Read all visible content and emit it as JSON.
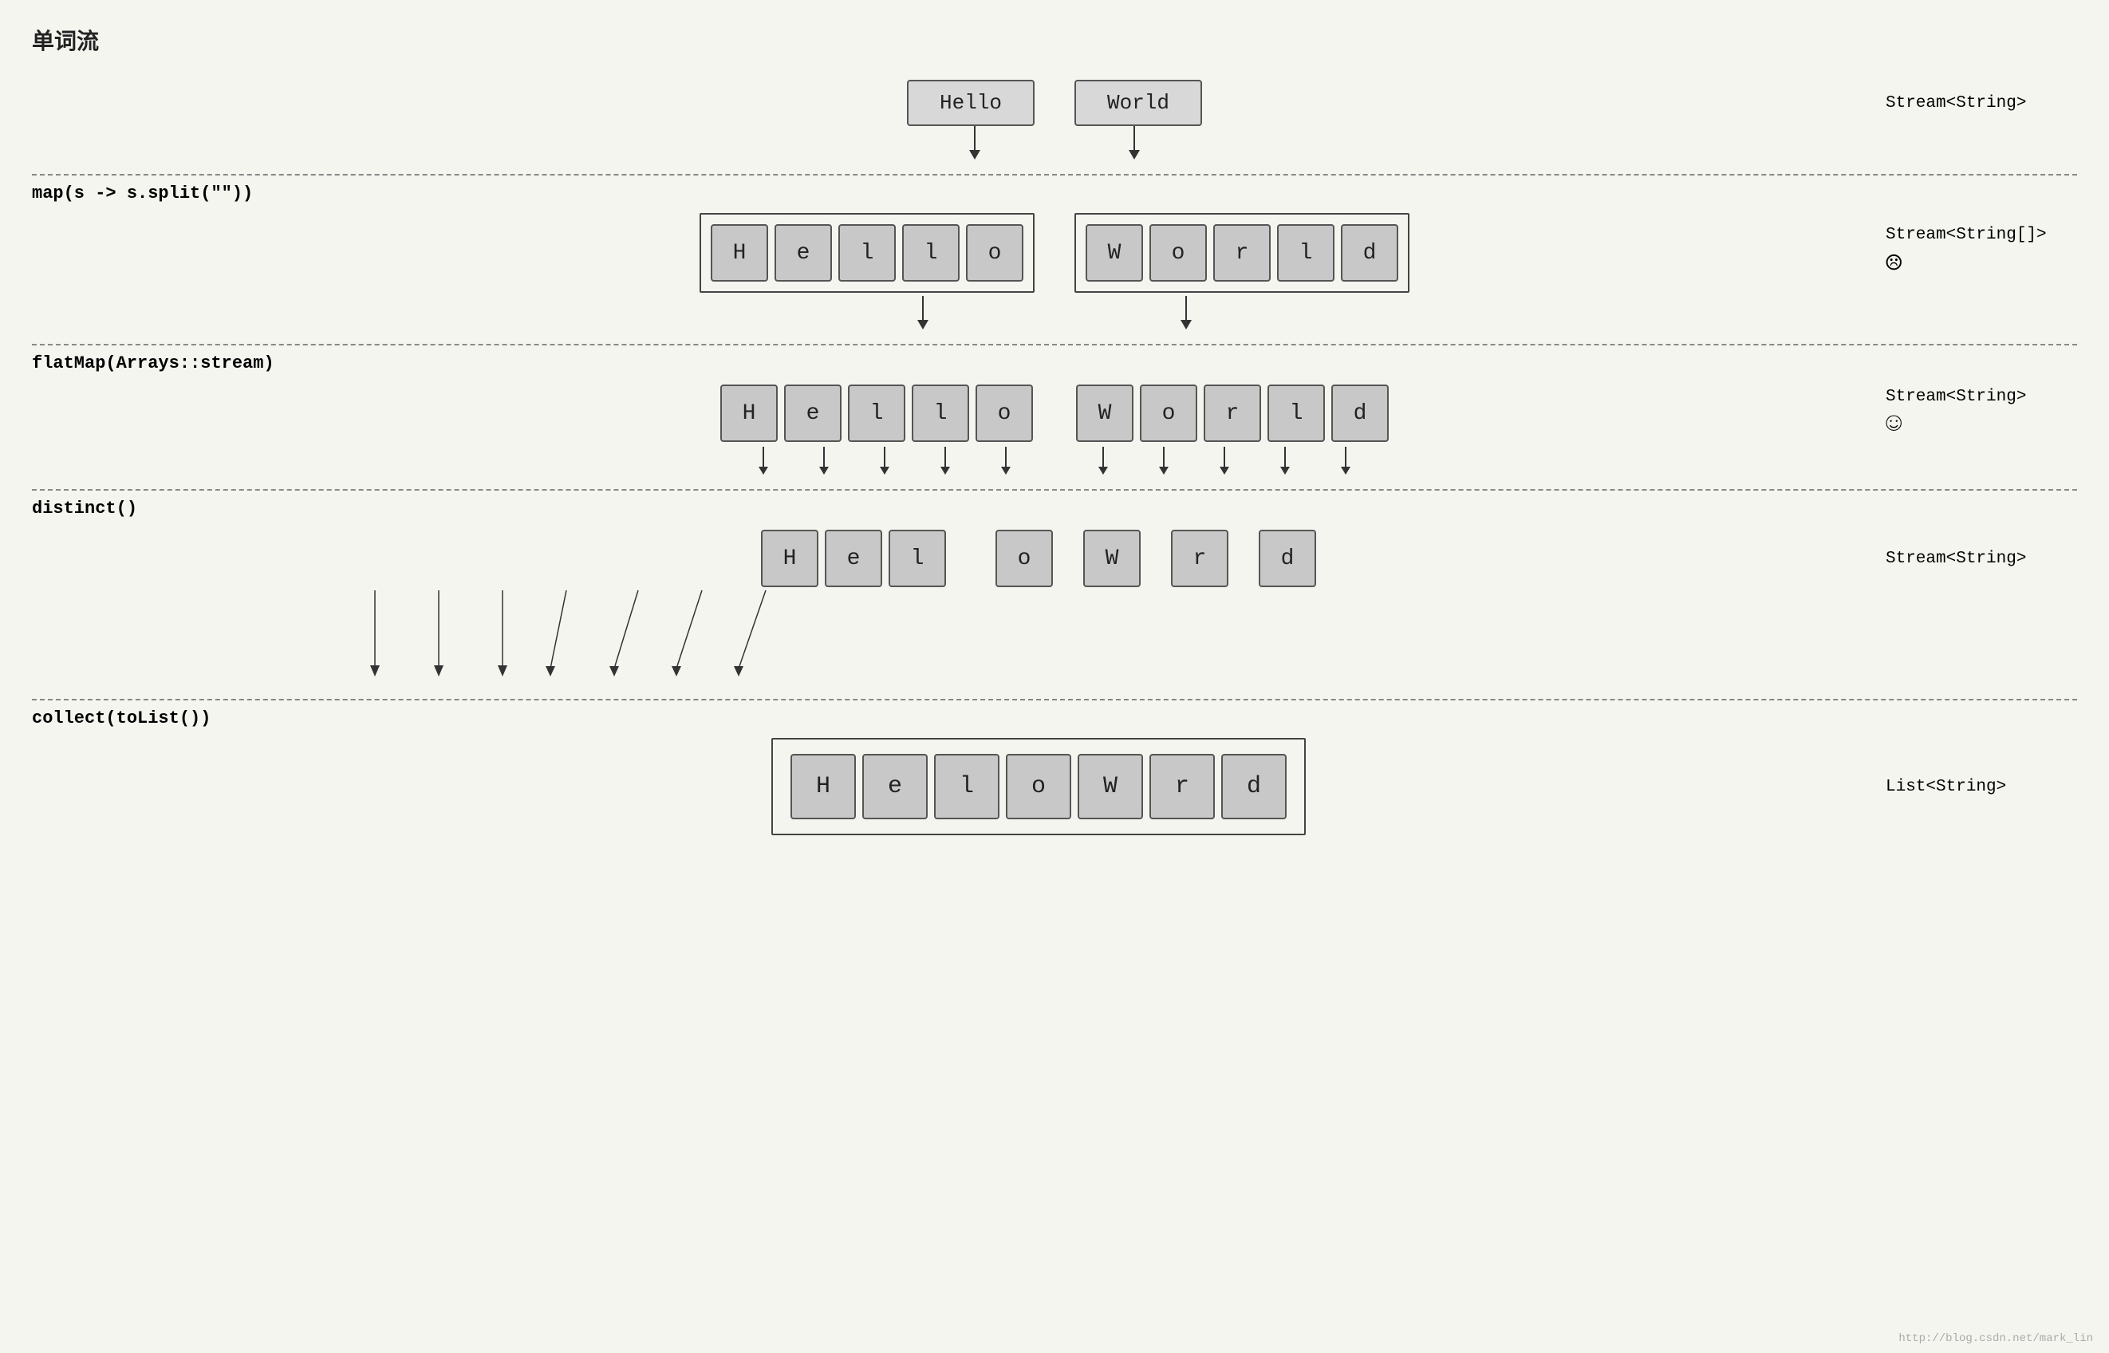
{
  "title": "单词流",
  "sections": {
    "top": {
      "words": [
        "Hello",
        "World"
      ],
      "stream_label": "Stream<String>"
    },
    "map": {
      "label_keyword": "map",
      "label_rest": "(s -> s.split(\"\"))",
      "hello_letters": [
        "H",
        "e",
        "l",
        "l",
        "o"
      ],
      "world_letters": [
        "W",
        "o",
        "r",
        "l",
        "d"
      ],
      "stream_label": "Stream<String[]>",
      "emoji": "☹"
    },
    "flatmap": {
      "label_keyword": "flatMap",
      "label_rest": "(Arrays::stream)",
      "letters": [
        "H",
        "e",
        "l",
        "l",
        "o",
        "W",
        "o",
        "r",
        "l",
        "d"
      ],
      "stream_label": "Stream<String>",
      "emoji": "☺"
    },
    "distinct": {
      "label_keyword": "distinct",
      "label_rest": "()",
      "letters": [
        "H",
        "e",
        "l",
        "o",
        "W",
        "r",
        "d"
      ],
      "stream_label": "Stream<String>"
    },
    "collect": {
      "label_keyword": "collect",
      "label_rest": "(toList())",
      "letters": [
        "H",
        "e",
        "l",
        "o",
        "W",
        "r",
        "d"
      ],
      "stream_label": "List<String>"
    }
  },
  "watermark": "http://blog.csdn.net/mark_lin"
}
